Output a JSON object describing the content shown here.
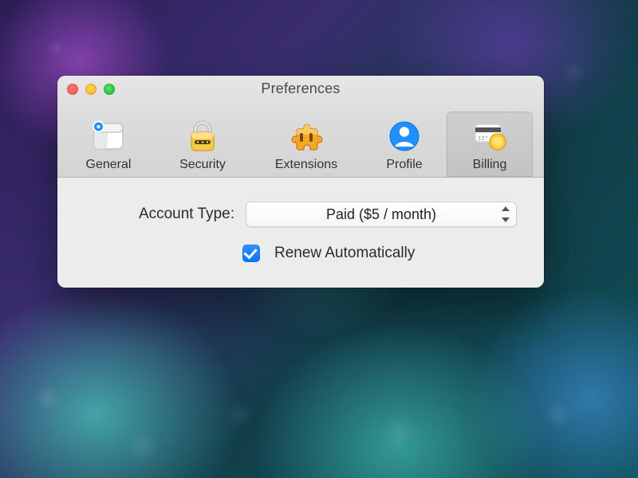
{
  "window": {
    "title": "Preferences"
  },
  "tabs": [
    {
      "id": "general",
      "label": "General",
      "selected": false
    },
    {
      "id": "security",
      "label": "Security",
      "selected": false
    },
    {
      "id": "extensions",
      "label": "Extensions",
      "selected": false
    },
    {
      "id": "profile",
      "label": "Profile",
      "selected": false
    },
    {
      "id": "billing",
      "label": "Billing",
      "selected": true
    }
  ],
  "billing": {
    "account_type_label": "Account Type:",
    "account_type_value": "Paid ($5 / month)",
    "renew_checked": true,
    "renew_label": "Renew Automatically"
  }
}
